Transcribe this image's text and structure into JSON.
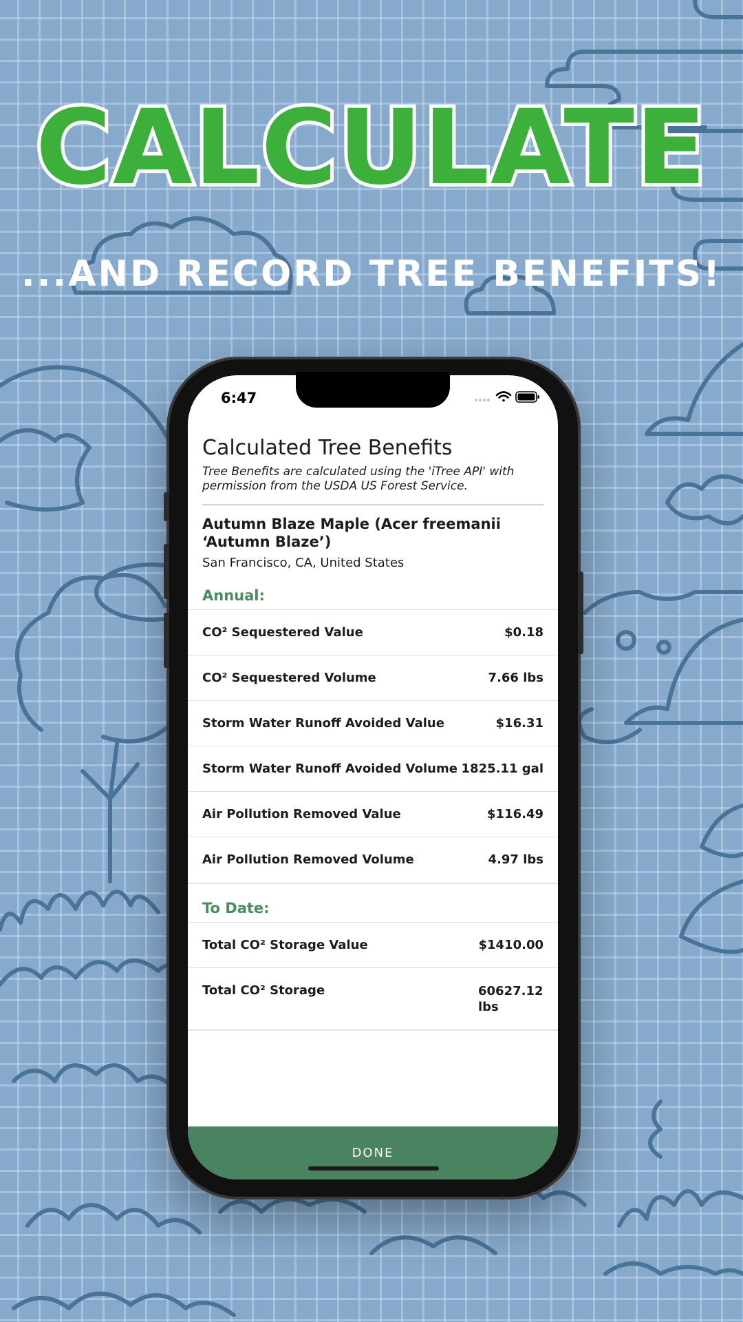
{
  "promo": {
    "headline": "CALCULATE",
    "subheadline": "...AND RECORD TREE BENEFITS!"
  },
  "status_bar": {
    "time": "6:47",
    "icons": [
      "signal-icon",
      "wifi-icon",
      "battery-icon"
    ]
  },
  "screen": {
    "title": "Calculated Tree Benefits",
    "disclaimer": "Tree Benefits are calculated using the 'iTree API' with permission from the USDA US Forest Service.",
    "tree_name": "Autumn Blaze Maple (Acer freemanii ‘Autumn Blaze’)",
    "location": "San Francisco, CA, United States",
    "annual": {
      "heading": "Annual:",
      "rows": [
        {
          "label": "CO² Sequestered Value",
          "value": "$0.18"
        },
        {
          "label": "CO² Sequestered Volume",
          "value": "7.66 lbs"
        },
        {
          "label": "Storm Water Runoff Avoided Value",
          "value": "$16.31"
        },
        {
          "label": "Storm Water Runoff Avoided Volume",
          "value": "1825.11 gal"
        },
        {
          "label": "Air Pollution Removed Value",
          "value": "$116.49"
        },
        {
          "label": "Air Pollution Removed Volume",
          "value": "4.97 lbs"
        }
      ]
    },
    "to_date": {
      "heading": "To Date:",
      "rows": [
        {
          "label": "Total CO² Storage Value",
          "value": "$1410.00"
        },
        {
          "label": "Total CO² Storage",
          "value": "60627.12 lbs"
        }
      ]
    },
    "done_label": "DONE"
  },
  "colors": {
    "background": "#87a9cb",
    "headline_green": "#3daf3b",
    "section_green": "#4b8c5f",
    "done_bar": "#4a8360"
  }
}
